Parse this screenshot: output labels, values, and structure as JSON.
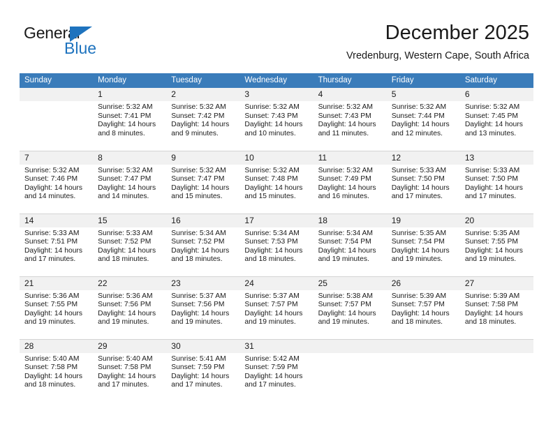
{
  "logo": {
    "word_one": "General",
    "word_two": "Blue",
    "accent_color": "#1e73be",
    "triangle_icon": "triangle-icon"
  },
  "header": {
    "title": "December 2025",
    "location": "Vredenburg, Western Cape, South Africa"
  },
  "calendar": {
    "header_color": "#3a7cba",
    "daynum_bg": "#f1f1f1",
    "weekday_headers": [
      "Sunday",
      "Monday",
      "Tuesday",
      "Wednesday",
      "Thursday",
      "Friday",
      "Saturday"
    ],
    "labels": {
      "sunrise_prefix": "Sunrise: ",
      "sunset_prefix": "Sunset: ",
      "daylight_prefix": "Daylight: "
    },
    "weeks": [
      [
        {
          "day": "",
          "empty": true
        },
        {
          "day": "1",
          "sunrise": "Sunrise: 5:32 AM",
          "sunset": "Sunset: 7:41 PM",
          "daylight": "Daylight: 14 hours and 8 minutes."
        },
        {
          "day": "2",
          "sunrise": "Sunrise: 5:32 AM",
          "sunset": "Sunset: 7:42 PM",
          "daylight": "Daylight: 14 hours and 9 minutes."
        },
        {
          "day": "3",
          "sunrise": "Sunrise: 5:32 AM",
          "sunset": "Sunset: 7:43 PM",
          "daylight": "Daylight: 14 hours and 10 minutes."
        },
        {
          "day": "4",
          "sunrise": "Sunrise: 5:32 AM",
          "sunset": "Sunset: 7:43 PM",
          "daylight": "Daylight: 14 hours and 11 minutes."
        },
        {
          "day": "5",
          "sunrise": "Sunrise: 5:32 AM",
          "sunset": "Sunset: 7:44 PM",
          "daylight": "Daylight: 14 hours and 12 minutes."
        },
        {
          "day": "6",
          "sunrise": "Sunrise: 5:32 AM",
          "sunset": "Sunset: 7:45 PM",
          "daylight": "Daylight: 14 hours and 13 minutes."
        }
      ],
      [
        {
          "day": "7",
          "sunrise": "Sunrise: 5:32 AM",
          "sunset": "Sunset: 7:46 PM",
          "daylight": "Daylight: 14 hours and 14 minutes."
        },
        {
          "day": "8",
          "sunrise": "Sunrise: 5:32 AM",
          "sunset": "Sunset: 7:47 PM",
          "daylight": "Daylight: 14 hours and 14 minutes."
        },
        {
          "day": "9",
          "sunrise": "Sunrise: 5:32 AM",
          "sunset": "Sunset: 7:47 PM",
          "daylight": "Daylight: 14 hours and 15 minutes."
        },
        {
          "day": "10",
          "sunrise": "Sunrise: 5:32 AM",
          "sunset": "Sunset: 7:48 PM",
          "daylight": "Daylight: 14 hours and 15 minutes."
        },
        {
          "day": "11",
          "sunrise": "Sunrise: 5:32 AM",
          "sunset": "Sunset: 7:49 PM",
          "daylight": "Daylight: 14 hours and 16 minutes."
        },
        {
          "day": "12",
          "sunrise": "Sunrise: 5:33 AM",
          "sunset": "Sunset: 7:50 PM",
          "daylight": "Daylight: 14 hours and 17 minutes."
        },
        {
          "day": "13",
          "sunrise": "Sunrise: 5:33 AM",
          "sunset": "Sunset: 7:50 PM",
          "daylight": "Daylight: 14 hours and 17 minutes."
        }
      ],
      [
        {
          "day": "14",
          "sunrise": "Sunrise: 5:33 AM",
          "sunset": "Sunset: 7:51 PM",
          "daylight": "Daylight: 14 hours and 17 minutes."
        },
        {
          "day": "15",
          "sunrise": "Sunrise: 5:33 AM",
          "sunset": "Sunset: 7:52 PM",
          "daylight": "Daylight: 14 hours and 18 minutes."
        },
        {
          "day": "16",
          "sunrise": "Sunrise: 5:34 AM",
          "sunset": "Sunset: 7:52 PM",
          "daylight": "Daylight: 14 hours and 18 minutes."
        },
        {
          "day": "17",
          "sunrise": "Sunrise: 5:34 AM",
          "sunset": "Sunset: 7:53 PM",
          "daylight": "Daylight: 14 hours and 18 minutes."
        },
        {
          "day": "18",
          "sunrise": "Sunrise: 5:34 AM",
          "sunset": "Sunset: 7:54 PM",
          "daylight": "Daylight: 14 hours and 19 minutes."
        },
        {
          "day": "19",
          "sunrise": "Sunrise: 5:35 AM",
          "sunset": "Sunset: 7:54 PM",
          "daylight": "Daylight: 14 hours and 19 minutes."
        },
        {
          "day": "20",
          "sunrise": "Sunrise: 5:35 AM",
          "sunset": "Sunset: 7:55 PM",
          "daylight": "Daylight: 14 hours and 19 minutes."
        }
      ],
      [
        {
          "day": "21",
          "sunrise": "Sunrise: 5:36 AM",
          "sunset": "Sunset: 7:55 PM",
          "daylight": "Daylight: 14 hours and 19 minutes."
        },
        {
          "day": "22",
          "sunrise": "Sunrise: 5:36 AM",
          "sunset": "Sunset: 7:56 PM",
          "daylight": "Daylight: 14 hours and 19 minutes."
        },
        {
          "day": "23",
          "sunrise": "Sunrise: 5:37 AM",
          "sunset": "Sunset: 7:56 PM",
          "daylight": "Daylight: 14 hours and 19 minutes."
        },
        {
          "day": "24",
          "sunrise": "Sunrise: 5:37 AM",
          "sunset": "Sunset: 7:57 PM",
          "daylight": "Daylight: 14 hours and 19 minutes."
        },
        {
          "day": "25",
          "sunrise": "Sunrise: 5:38 AM",
          "sunset": "Sunset: 7:57 PM",
          "daylight": "Daylight: 14 hours and 19 minutes."
        },
        {
          "day": "26",
          "sunrise": "Sunrise: 5:39 AM",
          "sunset": "Sunset: 7:57 PM",
          "daylight": "Daylight: 14 hours and 18 minutes."
        },
        {
          "day": "27",
          "sunrise": "Sunrise: 5:39 AM",
          "sunset": "Sunset: 7:58 PM",
          "daylight": "Daylight: 14 hours and 18 minutes."
        }
      ],
      [
        {
          "day": "28",
          "sunrise": "Sunrise: 5:40 AM",
          "sunset": "Sunset: 7:58 PM",
          "daylight": "Daylight: 14 hours and 18 minutes."
        },
        {
          "day": "29",
          "sunrise": "Sunrise: 5:40 AM",
          "sunset": "Sunset: 7:58 PM",
          "daylight": "Daylight: 14 hours and 17 minutes."
        },
        {
          "day": "30",
          "sunrise": "Sunrise: 5:41 AM",
          "sunset": "Sunset: 7:59 PM",
          "daylight": "Daylight: 14 hours and 17 minutes."
        },
        {
          "day": "31",
          "sunrise": "Sunrise: 5:42 AM",
          "sunset": "Sunset: 7:59 PM",
          "daylight": "Daylight: 14 hours and 17 minutes."
        },
        {
          "day": "",
          "empty": true
        },
        {
          "day": "",
          "empty": true
        },
        {
          "day": "",
          "empty": true
        }
      ]
    ]
  }
}
